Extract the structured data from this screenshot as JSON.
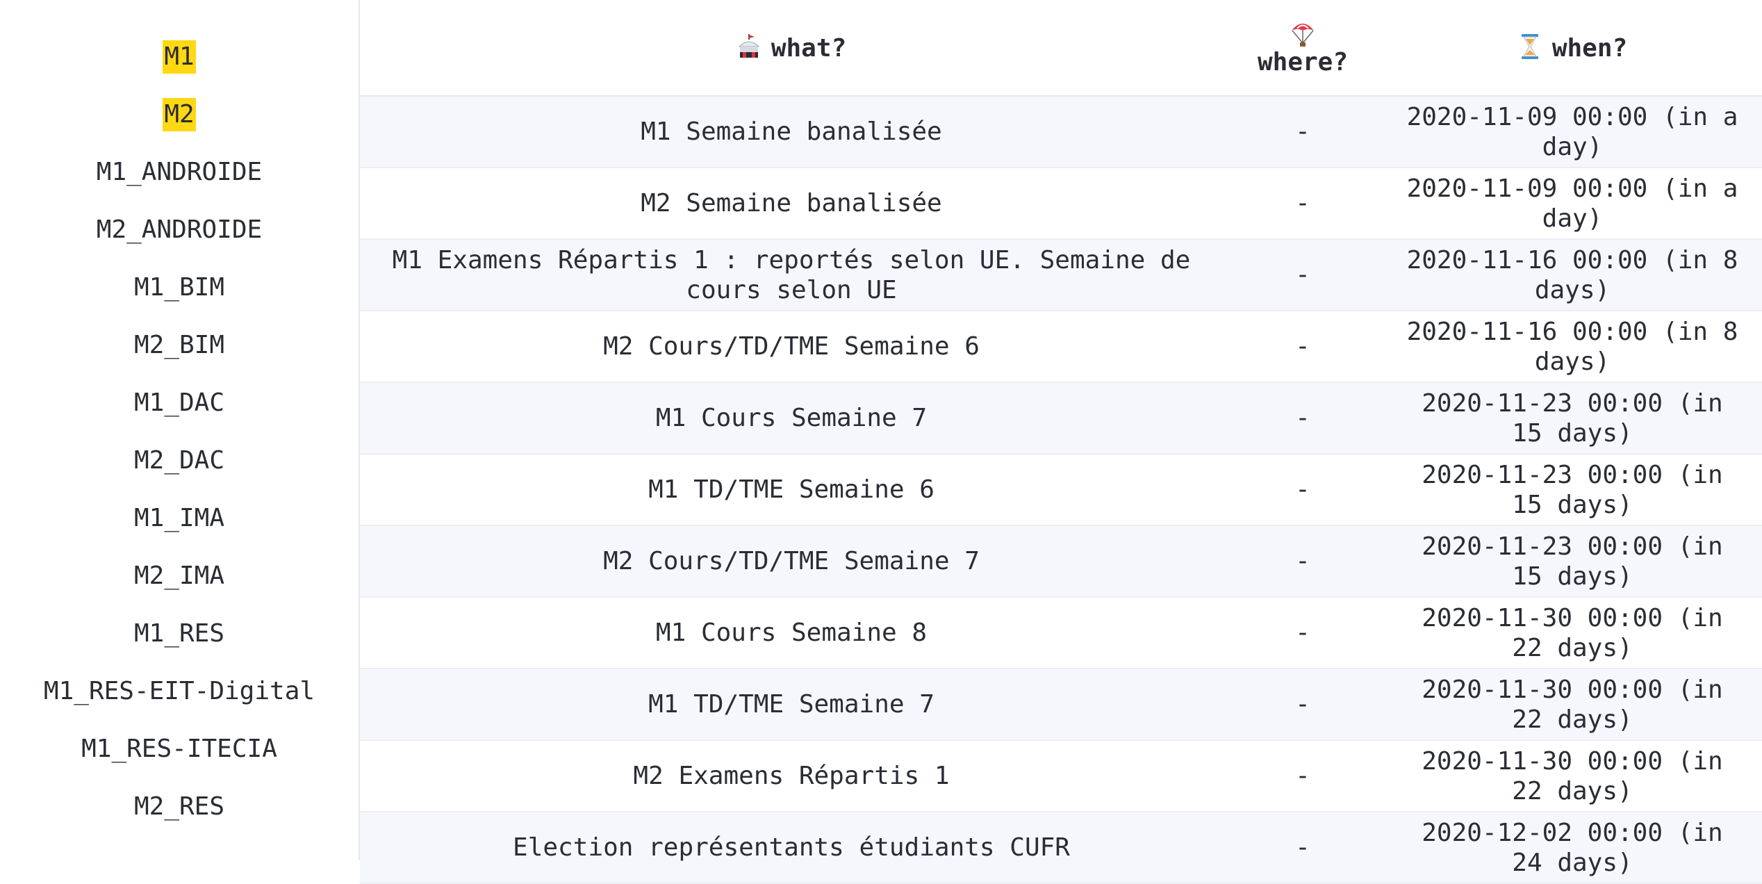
{
  "sidebar": {
    "items": [
      {
        "label": "M1",
        "highlighted": true
      },
      {
        "label": "M2",
        "highlighted": true
      },
      {
        "label": "M1_ANDROIDE",
        "highlighted": false
      },
      {
        "label": "M2_ANDROIDE",
        "highlighted": false
      },
      {
        "label": "M1_BIM",
        "highlighted": false
      },
      {
        "label": "M2_BIM",
        "highlighted": false
      },
      {
        "label": "M1_DAC",
        "highlighted": false
      },
      {
        "label": "M2_DAC",
        "highlighted": false
      },
      {
        "label": "M1_IMA",
        "highlighted": false
      },
      {
        "label": "M2_IMA",
        "highlighted": false
      },
      {
        "label": "M1_RES",
        "highlighted": false
      },
      {
        "label": "M1_RES-EIT-Digital",
        "highlighted": false
      },
      {
        "label": "M1_RES-ITECIA",
        "highlighted": false
      },
      {
        "label": "M2_RES",
        "highlighted": false
      }
    ],
    "highlight_color": "#ffd814"
  },
  "table": {
    "headers": {
      "what": {
        "label": "what?",
        "icon": "circus-tent-icon"
      },
      "where": {
        "label": "where?",
        "icon": "parachute-icon"
      },
      "when": {
        "label": "when?",
        "icon": "hourglass-icon"
      }
    },
    "rows": [
      {
        "what": "M1 Semaine banalisée",
        "where": "-",
        "when": "2020-11-09 00:00 (in a day)"
      },
      {
        "what": "M2 Semaine banalisée",
        "where": "-",
        "when": "2020-11-09 00:00 (in a day)"
      },
      {
        "what": "M1 Examens Répartis 1 : reportés selon UE. Semaine de cours selon UE",
        "where": "-",
        "when": "2020-11-16 00:00 (in 8 days)"
      },
      {
        "what": "M2 Cours/TD/TME Semaine 6",
        "where": "-",
        "when": "2020-11-16 00:00 (in 8 days)"
      },
      {
        "what": "M1 Cours Semaine 7",
        "where": "-",
        "when": "2020-11-23 00:00 (in 15 days)"
      },
      {
        "what": "M1 TD/TME Semaine 6",
        "where": "-",
        "when": "2020-11-23 00:00 (in 15 days)"
      },
      {
        "what": "M2 Cours/TD/TME Semaine 7",
        "where": "-",
        "when": "2020-11-23 00:00 (in 15 days)"
      },
      {
        "what": "M1 Cours Semaine 8",
        "where": "-",
        "when": "2020-11-30 00:00 (in 22 days)"
      },
      {
        "what": "M1 TD/TME Semaine 7",
        "where": "-",
        "when": "2020-11-30 00:00 (in 22 days)"
      },
      {
        "what": "M2 Examens Répartis 1",
        "where": "-",
        "when": "2020-11-30 00:00 (in 22 days)"
      },
      {
        "what": "Election représentants étudiants CUFR",
        "where": "-",
        "when": "2020-12-02 00:00 (in 24 days)"
      }
    ]
  }
}
